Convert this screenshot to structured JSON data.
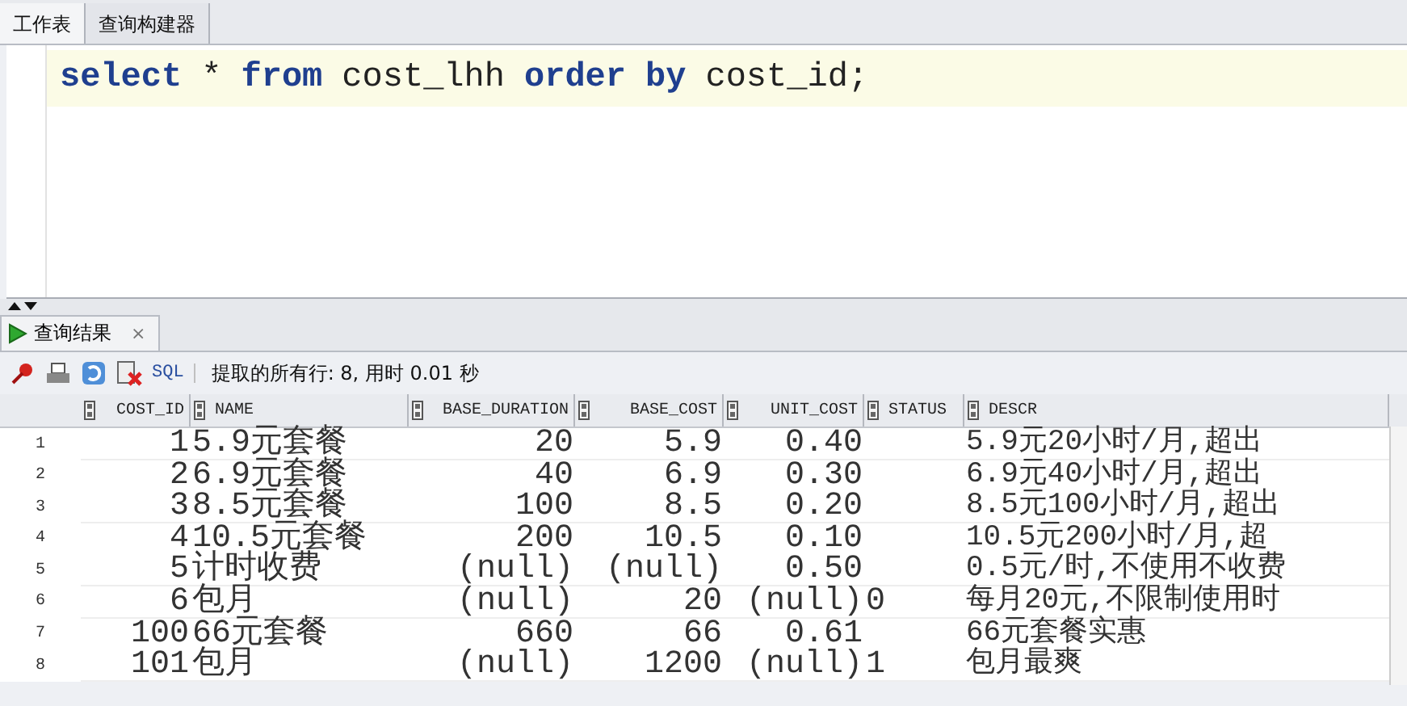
{
  "worksheet_tabs": [
    {
      "label": "工作表",
      "selected": true
    },
    {
      "label": "查询构建器",
      "selected": false
    }
  ],
  "editor": {
    "tokens": [
      {
        "text": "select",
        "kind": "keyword"
      },
      {
        "text": "*",
        "kind": "plain"
      },
      {
        "text": "from",
        "kind": "keyword"
      },
      {
        "text": "cost_lhh",
        "kind": "plain"
      },
      {
        "text": "order",
        "kind": "keyword"
      },
      {
        "text": "by",
        "kind": "keyword"
      },
      {
        "text": "cost_id;",
        "kind": "plain"
      }
    ]
  },
  "results": {
    "tab": {
      "label": "查询结果",
      "close": "×"
    },
    "toolbar": {
      "sql_link": "SQL",
      "status": "提取的所有行: 8, 用时 0.01 秒"
    },
    "columns": [
      {
        "label": "COST_ID"
      },
      {
        "label": "NAME"
      },
      {
        "label": "BASE_DURATION"
      },
      {
        "label": "BASE_COST"
      },
      {
        "label": "UNIT_COST"
      },
      {
        "label": "STATUS"
      },
      {
        "label": "DESCR"
      }
    ],
    "rows": [
      {
        "number": "1",
        "cells": [
          "1",
          "5.9元套餐",
          "20",
          "5.9",
          "0.40",
          "",
          "5.9元20小时/月,超出"
        ]
      },
      {
        "number": "2",
        "cells": [
          "2",
          "6.9元套餐",
          "40",
          "6.9",
          "0.30",
          "",
          "6.9元40小时/月,超出"
        ]
      },
      {
        "number": "3",
        "cells": [
          "3",
          "8.5元套餐",
          "100",
          "8.5",
          "0.20",
          "",
          "8.5元100小时/月,超出"
        ]
      },
      {
        "number": "4",
        "cells": [
          "4",
          "10.5元套餐",
          "200",
          "10.5",
          "0.10",
          "",
          "10.5元200小时/月,超"
        ]
      },
      {
        "number": "5",
        "cells": [
          "5",
          "计时收费",
          "(null)",
          "(null)",
          "0.50",
          "",
          "0.5元/时,不使用不收费"
        ]
      },
      {
        "number": "6",
        "cells": [
          "6",
          "包月",
          "(null)",
          "20",
          "(null)",
          "0",
          "每月20元,不限制使用时"
        ]
      },
      {
        "number": "7",
        "cells": [
          "100",
          "66元套餐",
          "660",
          "66",
          "0.61",
          "",
          "66元套餐实惠"
        ]
      },
      {
        "number": "8",
        "cells": [
          "101",
          "包月",
          "(null)",
          "1200",
          "(null)",
          "1",
          "包月最爽"
        ]
      }
    ]
  }
}
